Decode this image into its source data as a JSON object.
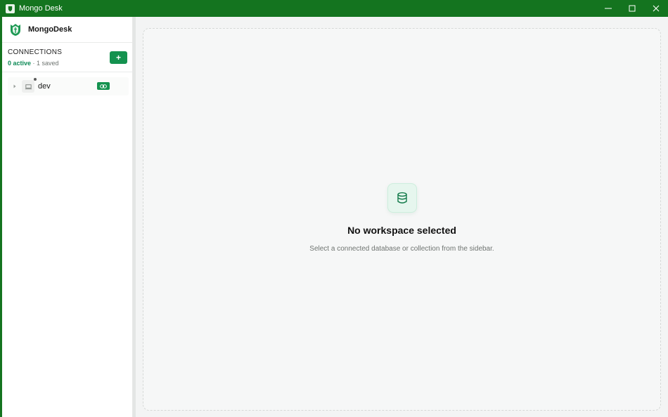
{
  "window": {
    "title": "Mongo Desk",
    "accent_color": "#14741f"
  },
  "sidebar": {
    "brand_name": "MongoDesk",
    "connections_title": "CONNECTIONS",
    "active_label": "0 active",
    "separator": " · ",
    "saved_label": "1 saved",
    "add_button_label": "+",
    "items": [
      {
        "name": "dev",
        "icon": "laptop-icon",
        "badge_icon": "link-icon"
      }
    ]
  },
  "main": {
    "empty_icon": "database-icon",
    "empty_title": "No workspace selected",
    "empty_subtitle": "Select a connected database or collection from the sidebar."
  },
  "colors": {
    "primary_green": "#14924f",
    "active_text": "#0f8a57"
  }
}
